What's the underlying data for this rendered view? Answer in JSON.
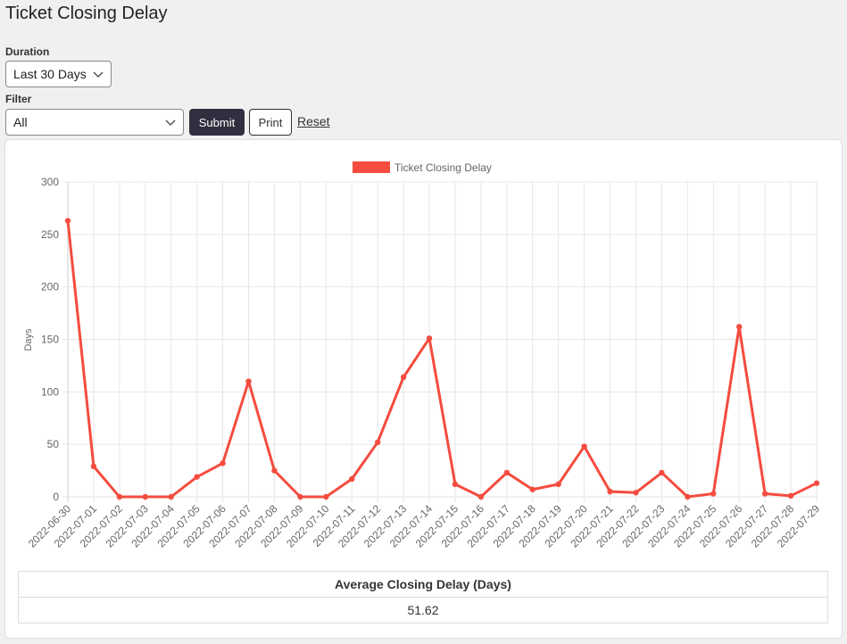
{
  "page": {
    "title": "Ticket Closing Delay"
  },
  "filters": {
    "duration_label": "Duration",
    "duration_value": "Last 30 Days",
    "filter_label": "Filter",
    "filter_value": "All",
    "submit_label": "Submit",
    "print_label": "Print",
    "reset_label": "Reset"
  },
  "colors": {
    "series": "#f44c3f",
    "grid": "#e6e6e6",
    "submit_bg": "#2f2f3f"
  },
  "summary": {
    "header": "Average Closing Delay (Days)",
    "value": "51.62"
  },
  "chart_data": {
    "type": "line",
    "title": "",
    "legend": {
      "entries": [
        "Ticket Closing Delay"
      ],
      "position": "top"
    },
    "xlabel": "",
    "ylabel": "Days",
    "ylim": [
      0,
      300
    ],
    "yticks": [
      0,
      50,
      100,
      150,
      200,
      250,
      300
    ],
    "grid": true,
    "x": [
      "2022-06-30",
      "2022-07-01",
      "2022-07-02",
      "2022-07-03",
      "2022-07-04",
      "2022-07-05",
      "2022-07-06",
      "2022-07-07",
      "2022-07-08",
      "2022-07-09",
      "2022-07-10",
      "2022-07-11",
      "2022-07-12",
      "2022-07-13",
      "2022-07-14",
      "2022-07-15",
      "2022-07-16",
      "2022-07-17",
      "2022-07-18",
      "2022-07-19",
      "2022-07-20",
      "2022-07-21",
      "2022-07-22",
      "2022-07-23",
      "2022-07-24",
      "2022-07-25",
      "2022-07-26",
      "2022-07-27",
      "2022-07-28",
      "2022-07-29"
    ],
    "series": [
      {
        "name": "Ticket Closing Delay",
        "values": [
          263,
          29,
          0,
          0,
          0,
          19,
          32,
          110,
          25,
          0,
          0,
          17,
          52,
          114,
          151,
          12,
          0,
          23,
          7,
          12,
          48,
          5,
          4,
          23,
          0,
          3,
          162,
          3,
          1,
          13
        ]
      }
    ]
  }
}
